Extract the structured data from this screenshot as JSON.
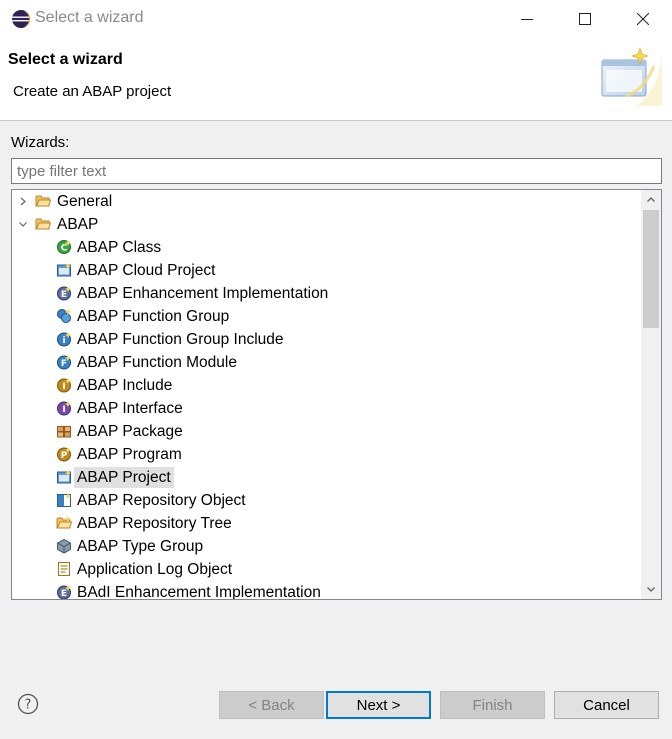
{
  "window": {
    "title": "Select a wizard"
  },
  "header": {
    "title": "Select a wizard",
    "description": "Create an ABAP project"
  },
  "wizards_label": "Wizards:",
  "filter": {
    "value": "",
    "placeholder": "type filter text"
  },
  "tree": {
    "items": [
      {
        "label": "General",
        "icon": "folder-icon",
        "expanded": false,
        "level": 0
      },
      {
        "label": "ABAP",
        "icon": "folder-open-icon",
        "expanded": true,
        "level": 0
      },
      {
        "label": "ABAP Class",
        "icon": "abap-class-icon",
        "level": 1
      },
      {
        "label": "ABAP Cloud Project",
        "icon": "abap-cloud-project-icon",
        "level": 1
      },
      {
        "label": "ABAP Enhancement Implementation",
        "icon": "abap-enhancement-icon",
        "level": 1
      },
      {
        "label": "ABAP Function Group",
        "icon": "abap-function-group-icon",
        "level": 1
      },
      {
        "label": "ABAP Function Group Include",
        "icon": "abap-function-group-include-icon",
        "level": 1
      },
      {
        "label": "ABAP Function Module",
        "icon": "abap-function-module-icon",
        "level": 1
      },
      {
        "label": "ABAP Include",
        "icon": "abap-include-icon",
        "level": 1
      },
      {
        "label": "ABAP Interface",
        "icon": "abap-interface-icon",
        "level": 1
      },
      {
        "label": "ABAP Package",
        "icon": "abap-package-icon",
        "level": 1
      },
      {
        "label": "ABAP Program",
        "icon": "abap-program-icon",
        "level": 1
      },
      {
        "label": "ABAP Project",
        "icon": "abap-project-icon",
        "level": 1,
        "selected": true
      },
      {
        "label": "ABAP Repository Object",
        "icon": "abap-repository-object-icon",
        "level": 1
      },
      {
        "label": "ABAP Repository Tree",
        "icon": "abap-repository-tree-icon",
        "level": 1
      },
      {
        "label": "ABAP Type Group",
        "icon": "abap-type-group-icon",
        "level": 1
      },
      {
        "label": "Application Log Object",
        "icon": "application-log-icon",
        "level": 1
      },
      {
        "label": "BAdI Enhancement Implementation",
        "icon": "badi-enhancement-icon",
        "level": 1
      }
    ]
  },
  "buttons": {
    "back": "< Back",
    "next": "Next >",
    "finish": "Finish",
    "cancel": "Cancel"
  },
  "colors": {
    "selection": "#e0e0e0",
    "default_button_border": "#0078d7",
    "dialog_bg": "#f0f0f0"
  }
}
